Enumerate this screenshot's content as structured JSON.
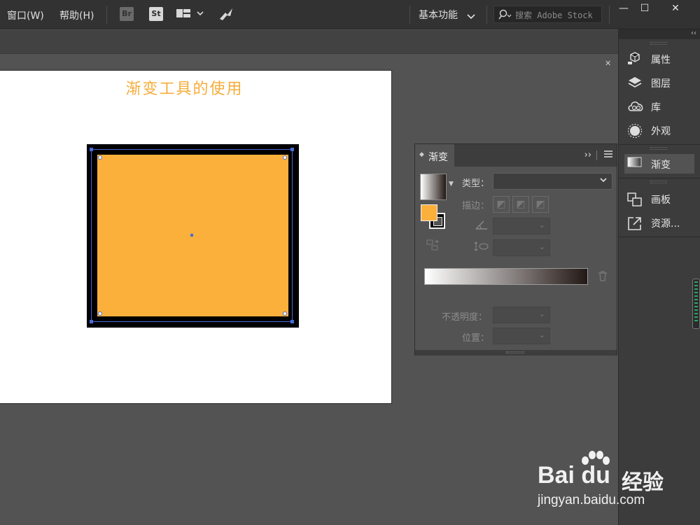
{
  "menubar": {
    "items": [
      "窗口(W)",
      "帮助(H)"
    ],
    "bridge_badge": "Br",
    "stock_badge": "St",
    "workspace_label": "基本功能",
    "search_placeholder": "搜索 Adobe Stock",
    "window_controls": [
      "—",
      "☐",
      "✕"
    ]
  },
  "artboard": {
    "title": "渐变工具的使用",
    "title_color": "#f5ad3b",
    "rect_fill": "#fbb03b",
    "rect_stroke": "#000000"
  },
  "dock": {
    "items": [
      {
        "label": "属性",
        "icon": "properties-icon"
      },
      {
        "label": "图层",
        "icon": "layers-icon"
      },
      {
        "label": "库",
        "icon": "libraries-icon"
      },
      {
        "label": "外观",
        "icon": "appearance-icon"
      },
      {
        "label": "渐变",
        "icon": "gradient-icon"
      },
      {
        "label": "画板",
        "icon": "artboards-icon"
      },
      {
        "label": "资源...",
        "icon": "asset-export-icon"
      }
    ],
    "collapse_glyph": "‹‹"
  },
  "gradient_panel": {
    "tab_label": "渐变",
    "more_glyph": "››",
    "type_label": "类型：",
    "type_value": "",
    "stroke_label": "描边：",
    "opacity_label": "不透明度：",
    "position_label": "位置：",
    "gradient_start": "#ffffff",
    "gradient_end": "#231815",
    "fill_color": "#fbb03b",
    "stroke_color": "#000000"
  },
  "watermark": {
    "logo": "Bai du",
    "logo_cn": "经验",
    "url": "jingyan.baidu.com"
  }
}
